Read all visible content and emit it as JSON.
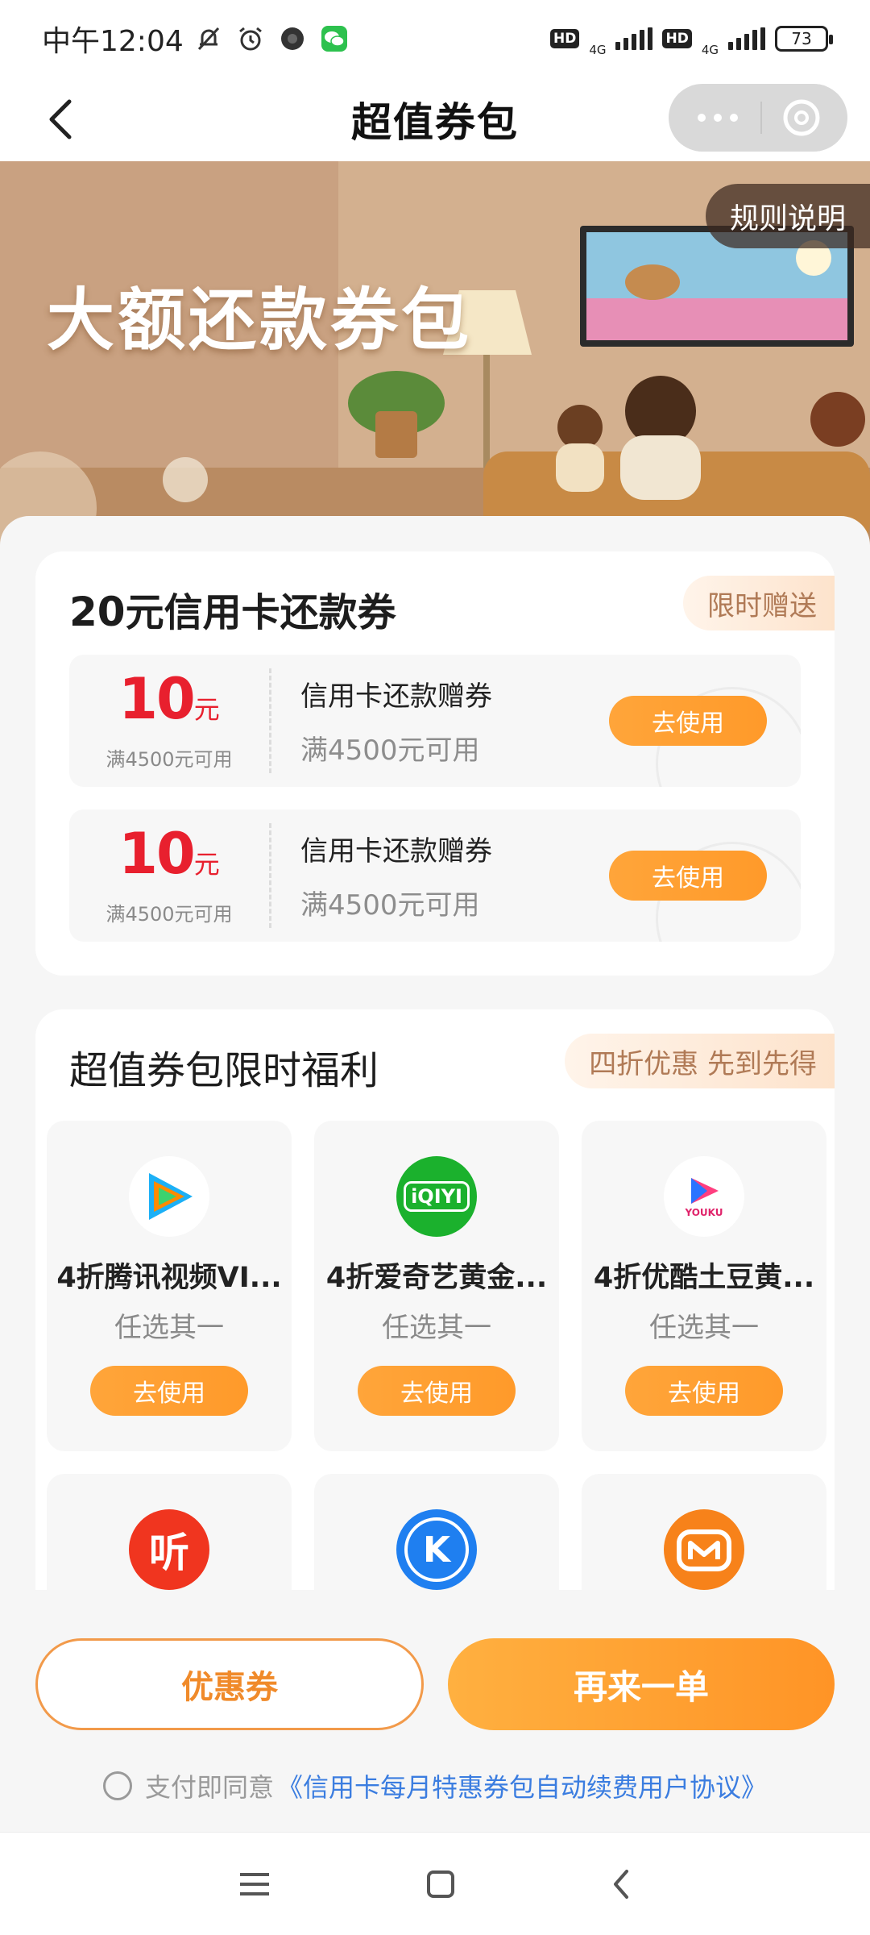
{
  "status_bar": {
    "time": "中午12:04",
    "left_icons": [
      "bell-off-icon",
      "alarm-icon",
      "camera-dot-icon",
      "wechat-icon"
    ],
    "hd1": "HD",
    "net1": "4G",
    "hd2": "HD",
    "net2": "4G",
    "battery": "73"
  },
  "nav": {
    "title": "超值券包",
    "more_label": "···"
  },
  "banner": {
    "title": "大额还款券包",
    "rules_label": "规则说明"
  },
  "section1": {
    "title_amount": "20",
    "title_rest": "元信用卡还款券",
    "badge": "限时赠送",
    "coupons": [
      {
        "amount": "10",
        "unit": "元",
        "condition": "满4500元可用",
        "name": "信用卡还款赠券",
        "subtitle": "满4500元可用",
        "button": "去使用"
      },
      {
        "amount": "10",
        "unit": "元",
        "condition": "满4500元可用",
        "name": "信用卡还款赠券",
        "subtitle": "满4500元可用",
        "button": "去使用"
      }
    ]
  },
  "section2": {
    "title": "超值券包限时福利",
    "badge": "四折优惠 先到先得",
    "tiles": [
      {
        "icon": "tencent-video-icon",
        "name": "4折腾讯视频VI...",
        "subtitle": "任选其一",
        "button": "去使用"
      },
      {
        "icon": "iqiyi-icon",
        "name": "4折爱奇艺黄金...",
        "subtitle": "任选其一",
        "button": "去使用"
      },
      {
        "icon": "youku-icon",
        "name": "4折优酷土豆黄...",
        "subtitle": "任选其一",
        "button": "去使用"
      },
      {
        "icon": "ximalaya-icon",
        "name": "",
        "subtitle": "",
        "button": ""
      },
      {
        "icon": "kugou-icon",
        "name": "",
        "subtitle": "",
        "button": ""
      },
      {
        "icon": "mango-tv-icon",
        "name": "",
        "subtitle": "",
        "button": ""
      }
    ],
    "icon_texts": {
      "iqiyi": "iQIYI",
      "youku": "YOUKU",
      "ximalaya": "听",
      "kugou": "K"
    }
  },
  "actions": {
    "coupon_button": "优惠券",
    "reorder_button": "再来一单",
    "agree_text": "支付即同意",
    "agree_link": "《信用卡每月特惠券包自动续费用户协议》"
  },
  "colors": {
    "accent_orange": "#ff9a2a",
    "price_red": "#e8202e",
    "link_blue": "#3b7de0"
  }
}
